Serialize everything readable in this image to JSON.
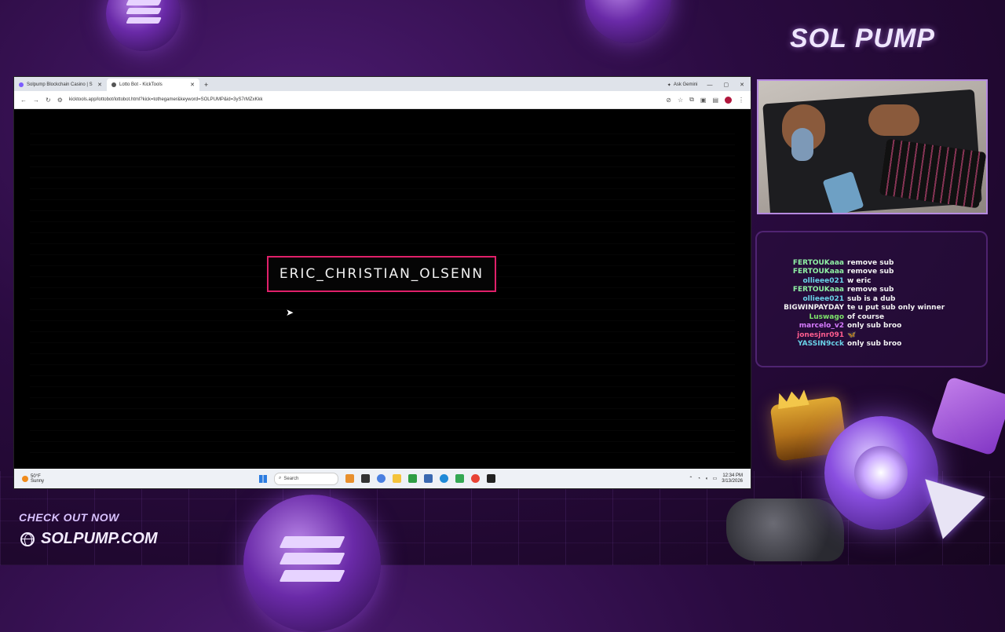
{
  "brand": {
    "logo_text": "SOL PUMP"
  },
  "browser": {
    "tabs": [
      {
        "label": "Solpump Blockchain Casino | S",
        "active": false
      },
      {
        "label": "Lotto Bot - KickTools",
        "active": true
      }
    ],
    "new_tab": "+",
    "ask_gemini": "Ask Gemini",
    "window_controls": {
      "minimize": "—",
      "maximize": "▢",
      "close": "✕"
    },
    "url": "kicktools.app/lottobot/lottobot.html?kick=tothegamer&keyword=SOLPUMP&id=3yS7rMZxKkk",
    "winner_name": "ERIC_CHRISTIAN_OLSENN"
  },
  "taskbar": {
    "weather_temp": "50°F",
    "weather_desc": "Sunny",
    "search_placeholder": "Search",
    "time": "12:34 PM",
    "date": "3/13/2026"
  },
  "chat": {
    "messages": [
      {
        "user": "FERTOUKaaa",
        "color": "#8ff0a4",
        "text": "remove sub"
      },
      {
        "user": "FERTOUKaaa",
        "color": "#8ff0a4",
        "text": "remove sub"
      },
      {
        "user": "ollieee021",
        "color": "#6ad3e8",
        "text": "w eric"
      },
      {
        "user": "FERTOUKaaa",
        "color": "#8ff0a4",
        "text": "remove sub"
      },
      {
        "user": "ollieee021",
        "color": "#6ad3e8",
        "text": "sub is a dub"
      },
      {
        "user": "BIGWINPAYDAY",
        "color": "#f2f2f2",
        "text": "te u put sub only winner"
      },
      {
        "user": "Luswago",
        "color": "#7de36a",
        "text": "of course"
      },
      {
        "user": "marcelo_v2",
        "color": "#d77cff",
        "text": "only sub broo"
      },
      {
        "user": "jonesjnr091",
        "color": "#ff5d8f",
        "text": "🦋"
      },
      {
        "user": "YASSIN9cck",
        "color": "#6ad3e8",
        "text": "only sub broo"
      }
    ]
  },
  "promo": {
    "line1": "CHECK OUT NOW",
    "line2": "SOLPUMP.COM"
  }
}
